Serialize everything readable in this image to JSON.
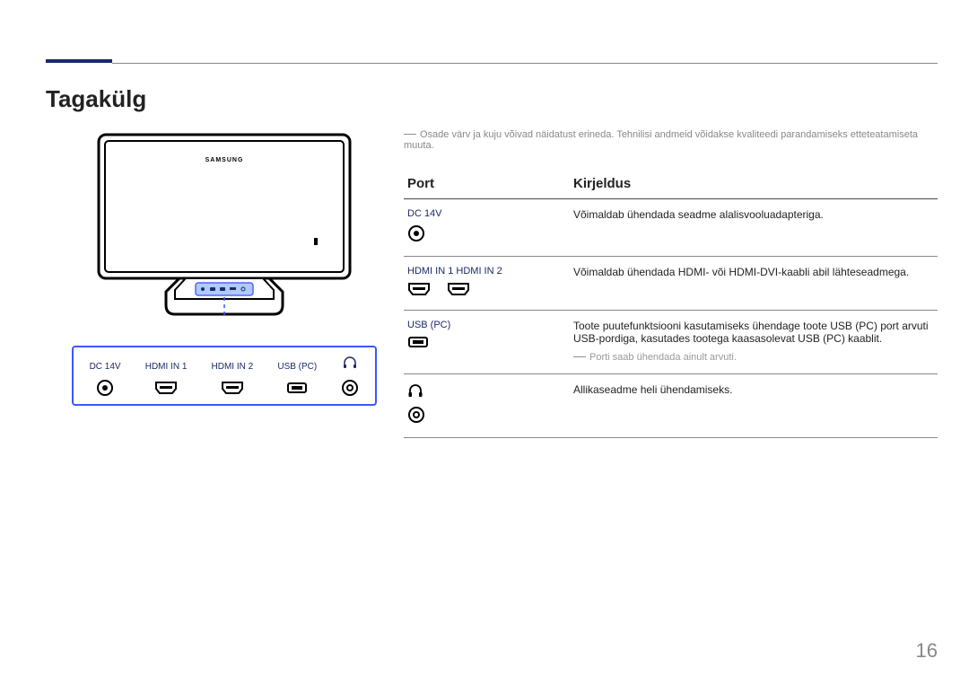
{
  "page": {
    "title": "Tagakülg",
    "number": "16"
  },
  "top_note": "Osade värv ja kuju võivad näidatust erineda. Tehnilisi andmeid võidakse kvaliteedi parandamiseks etteteatamiseta muuta.",
  "diagram": {
    "brand": "SAMSUNG",
    "panel_ports": {
      "dc": "DC 14V",
      "hdmi1": "HDMI IN 1",
      "hdmi2": "HDMI IN 2",
      "usb": "USB (PC)"
    }
  },
  "table": {
    "header_port": "Port",
    "header_desc": "Kirjeldus",
    "rows": [
      {
        "port_label": "DC 14V",
        "port_kind": "dc",
        "desc": "Võimaldab ühendada seadme alalisvooluadapteriga.",
        "sub": ""
      },
      {
        "port_label": "HDMI IN 1   HDMI IN 2",
        "port_kind": "hdmi",
        "desc": "Võimaldab ühendada HDMI- või HDMI-DVI-kaabli abil lähteseadmega.",
        "sub": ""
      },
      {
        "port_label": "USB (PC)",
        "port_kind": "usb",
        "desc": "Toote puutefunktsiooni kasutamiseks ühendage toote USB (PC) port arvuti USB-pordiga, kasutades tootega kaasasolevat USB (PC) kaablit.",
        "sub": "Porti saab ühendada ainult arvuti."
      },
      {
        "port_label": "",
        "port_kind": "headphone",
        "desc": "Allikaseadme heli ühendamiseks.",
        "sub": ""
      }
    ]
  }
}
